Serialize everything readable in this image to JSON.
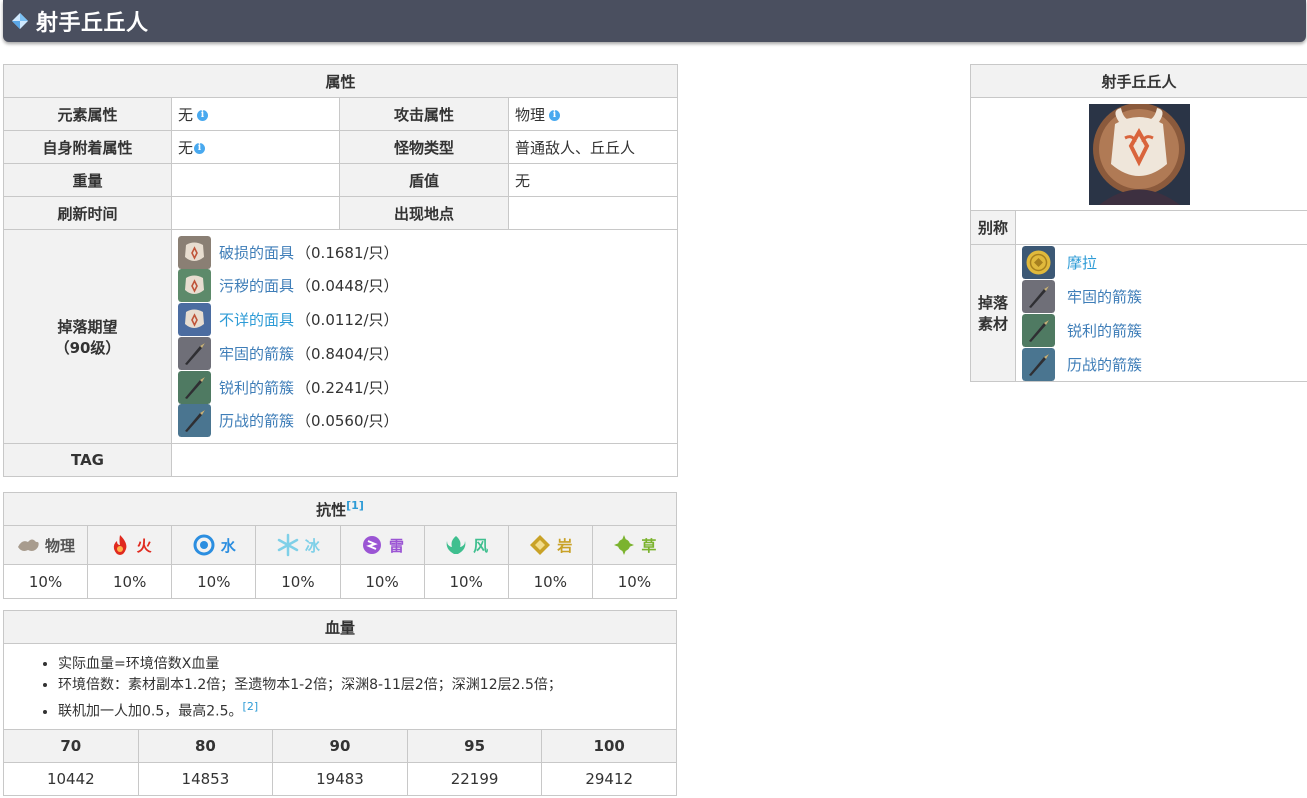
{
  "page": {
    "title": "射手丘丘人"
  },
  "attributes": {
    "header": "属性",
    "element_label": "元素属性",
    "element_value": "无",
    "attack_label": "攻击属性",
    "attack_value": "物理",
    "attach_label": "自身附着属性",
    "attach_value": "无",
    "monster_type_label": "怪物类型",
    "monster_type_value": "普通敌人、丘丘人",
    "weight_label": "重量",
    "weight_value": "",
    "shield_label": "盾值",
    "shield_value": "无",
    "refresh_label": "刷新时间",
    "refresh_value": "",
    "location_label": "出现地点",
    "location_value": "",
    "drop_label_line1": "掉落期望",
    "drop_label_line2": "（90级）",
    "drops": [
      {
        "name": "破损的面具",
        "rate": "（0.1681/只）",
        "icon": "mask-icon",
        "color": "#8a7f74"
      },
      {
        "name": "污秽的面具",
        "rate": "（0.0448/只）",
        "icon": "mask-icon",
        "color": "#5d8a6a"
      },
      {
        "name": "不详的面具",
        "rate": "（0.0112/只）",
        "icon": "mask-icon",
        "color": "#4b6ca0"
      },
      {
        "name": "牢固的箭簇",
        "rate": "（0.8404/只）",
        "icon": "arrowhead-icon",
        "color": "#6f6f78"
      },
      {
        "name": "锐利的箭簇",
        "rate": "（0.2241/只）",
        "icon": "arrowhead-icon",
        "color": "#4f7a62"
      },
      {
        "name": "历战的箭簇",
        "rate": "（0.0560/只）",
        "icon": "arrowhead-icon",
        "color": "#4a7590"
      }
    ],
    "tag_label": "TAG",
    "tag_value": ""
  },
  "resistance": {
    "header": "抗性",
    "ref": "[1]",
    "elements": [
      {
        "name": "物理",
        "value": "10%",
        "color": "#555555",
        "icon": "physical-icon"
      },
      {
        "name": "火",
        "value": "10%",
        "color": "#e02a1f",
        "icon": "pyro-icon"
      },
      {
        "name": "水",
        "value": "10%",
        "color": "#2b8ee0",
        "icon": "hydro-icon"
      },
      {
        "name": "冰",
        "value": "10%",
        "color": "#7fd0e8",
        "icon": "cryo-icon"
      },
      {
        "name": "雷",
        "value": "10%",
        "color": "#9b55d4",
        "icon": "electro-icon"
      },
      {
        "name": "风",
        "value": "10%",
        "color": "#3fbf8f",
        "icon": "anemo-icon"
      },
      {
        "name": "岩",
        "value": "10%",
        "color": "#c9a227",
        "icon": "geo-icon"
      },
      {
        "name": "草",
        "value": "10%",
        "color": "#7bb32e",
        "icon": "dendro-icon"
      }
    ]
  },
  "hp": {
    "header": "血量",
    "notes": [
      "实际血量=环境倍数X血量",
      "环境倍数：素材副本1.2倍；圣遗物本1-2倍；深渊8-11层2倍；深渊12层2.5倍；",
      "联机加一人加0.5，最高2.5。"
    ],
    "notes_ref": "[2]",
    "levels": [
      "70",
      "80",
      "90",
      "95",
      "100"
    ],
    "values": [
      "10442",
      "14853",
      "19483",
      "22199",
      "29412"
    ]
  },
  "side": {
    "title": "射手丘丘人",
    "alias_label": "别称",
    "alias_value": "",
    "materials_label_line1": "掉落",
    "materials_label_line2": "素材",
    "materials": [
      {
        "name": "摩拉",
        "icon": "mora-coin-icon",
        "color": "#c9a227",
        "highlight": true
      },
      {
        "name": "牢固的箭簇",
        "icon": "arrowhead-icon",
        "color": "#6f6f78",
        "highlight": false
      },
      {
        "name": "锐利的箭簇",
        "icon": "arrowhead-icon",
        "color": "#4f7a62",
        "highlight": false
      },
      {
        "name": "历战的箭簇",
        "icon": "arrowhead-icon",
        "color": "#4a7590",
        "highlight": false
      }
    ]
  }
}
